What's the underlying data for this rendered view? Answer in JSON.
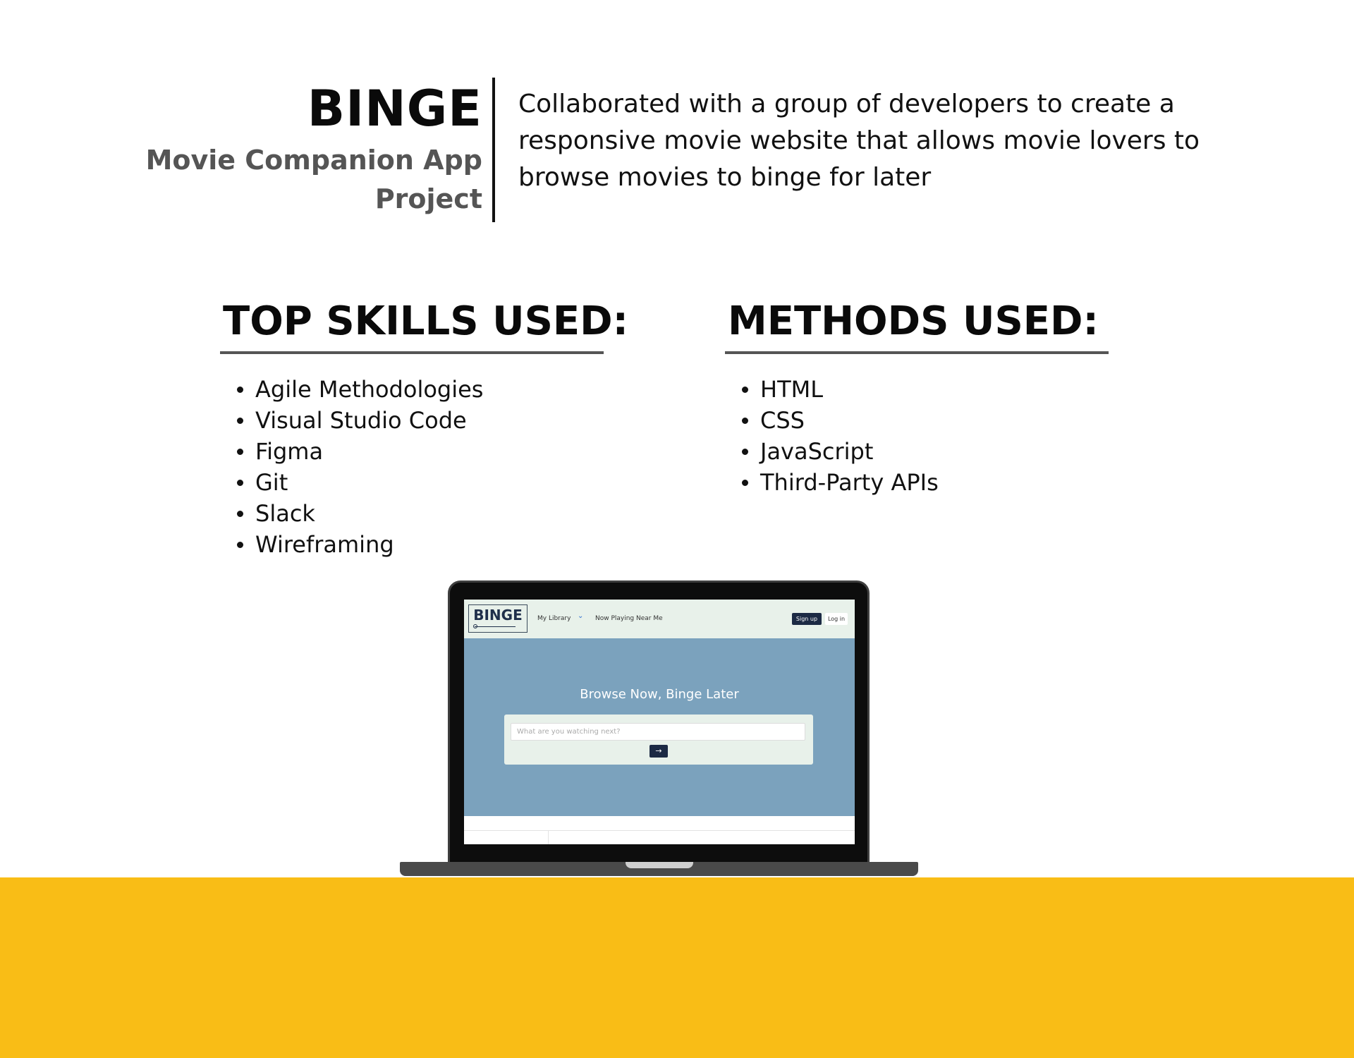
{
  "project": {
    "name": "BINGE",
    "subtitle_line1": "Movie Companion App",
    "subtitle_line2": "Project",
    "description": "Collaborated with a group of developers to create a responsive movie website that allows movie lovers to browse movies to binge for later"
  },
  "skills": {
    "heading": "TOP SKILLS USED:",
    "items": [
      "Agile Methodologies",
      "Visual Studio Code",
      "Figma",
      "Git",
      "Slack",
      "Wireframing"
    ]
  },
  "methods": {
    "heading": "METHODS USED:",
    "items": [
      "HTML",
      "CSS",
      "JavaScript",
      "Third-Party APIs"
    ]
  },
  "mockup": {
    "logo": "BINGE",
    "nav": {
      "library": "My Library",
      "library_icon": "chevron-down-icon",
      "now_playing": "Now Playing Near Me",
      "signup": "Sign up",
      "login": "Log in"
    },
    "hero": {
      "title": "Browse Now, Binge Later",
      "search_placeholder": "What are you watching next?",
      "search_button_icon": "arrow-right-icon"
    }
  },
  "colors": {
    "accent_yellow": "#f9bd16",
    "hero_blue": "#7ba2bd",
    "nav_mint": "#e8f1ea",
    "navy": "#1c2a44",
    "heading_gray": "#555555"
  }
}
